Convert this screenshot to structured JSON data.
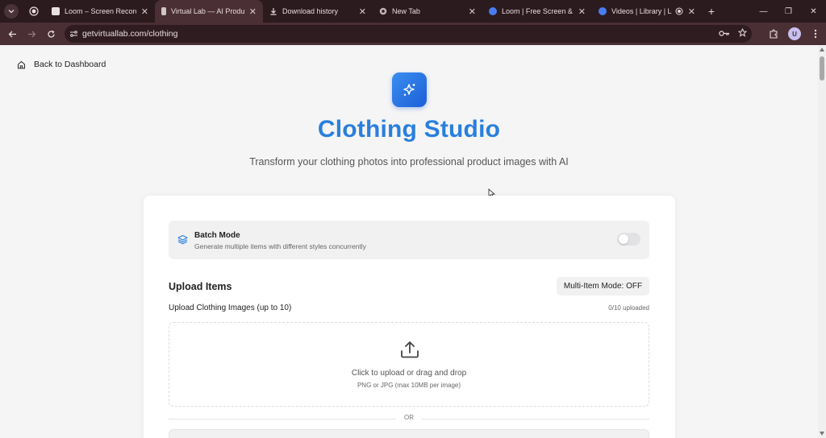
{
  "browser": {
    "tabs": [
      {
        "title": "Loom – Screen Recorder",
        "favicon_color": "#e8e0e2"
      },
      {
        "title": "Virtual Lab — AI Product",
        "favicon_color": "#cfc4c6",
        "active": true
      },
      {
        "title": "Download history",
        "favicon_color": "#e8dcde"
      },
      {
        "title": "New Tab",
        "favicon_color": "#bfb4b6"
      },
      {
        "title": "Loom | Free Screen & Vid",
        "favicon_color": "#4a7cf0"
      },
      {
        "title": "Videos | Library | Loom",
        "favicon_color": "#4a7cf0"
      }
    ],
    "url": "getvirtuallab.com/clothing",
    "profile_initial": "U",
    "colors": {
      "chrome_dark": "#2b1a1e",
      "chrome_toolbar": "#4a2f35"
    }
  },
  "page": {
    "back_link": "Back to Dashboard",
    "title": "Clothing Studio",
    "subtitle": "Transform your clothing photos into professional product images with AI",
    "batch_mode": {
      "title": "Batch Mode",
      "description": "Generate multiple items with different styles concurrently",
      "enabled": false
    },
    "upload_section": {
      "heading": "Upload Items",
      "multi_item_button": "Multi-Item Mode: OFF",
      "label": "Upload Clothing Images (up to 10)",
      "count": "0/10 uploaded",
      "dropzone_main": "Click to upload or drag and drop",
      "dropzone_hint": "PNG or JPG (max 10MB per image)",
      "divider": "OR"
    },
    "colors": {
      "accent": "#2a7fdc",
      "logo_gradient_start": "#3a8ef0",
      "logo_gradient_end": "#1c5fd8"
    }
  }
}
